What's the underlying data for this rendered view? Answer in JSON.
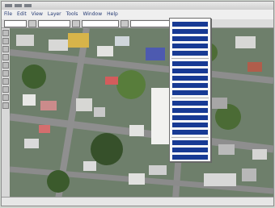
{
  "menu_items": [
    "File",
    "Edit",
    "View",
    "Layer",
    "Tools",
    "Window",
    "Help"
  ],
  "toolbar_fields": [
    "",
    "",
    "",
    ""
  ],
  "status_text": "",
  "context_menu": {
    "visible_text": [],
    "item_count": 31
  },
  "caption": ""
}
